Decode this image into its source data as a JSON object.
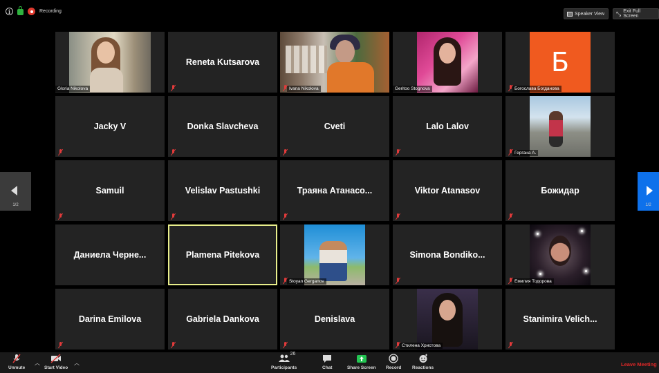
{
  "topbar": {
    "recording_label": "Recording",
    "speaker_view_label": "Speaker View",
    "fullscreen_label": "Exit Full Screen"
  },
  "participants": [
    {
      "name": "Gloria Nikolova",
      "display": "label"
    },
    {
      "name": "Reneta Kutsarova",
      "display": "name"
    },
    {
      "name": "Ivana Nikolova",
      "display": "label"
    },
    {
      "name": "Geritoo Stognova",
      "display": "label"
    },
    {
      "name": "Богослава Богданова",
      "display": "label"
    },
    {
      "name": "Jacky V",
      "display": "name"
    },
    {
      "name": "Donka Slavcheva",
      "display": "name"
    },
    {
      "name": "Cveti",
      "display": "name"
    },
    {
      "name": "Lalo Lalov",
      "display": "name"
    },
    {
      "name": "Гергана А.",
      "display": "label"
    },
    {
      "name": "Samuil",
      "display": "name"
    },
    {
      "name": "Velislav Pastushki",
      "display": "name"
    },
    {
      "name": "Траяна  Атанасо...",
      "display": "name"
    },
    {
      "name": "Viktor Atanasov",
      "display": "name"
    },
    {
      "name": "Божидар",
      "display": "name"
    },
    {
      "name": "Даниела  Черне...",
      "display": "name"
    },
    {
      "name": "Plamena Pitekova",
      "display": "name"
    },
    {
      "name": "Stoyan Gerganov",
      "display": "label"
    },
    {
      "name": "Simona  Bondiko...",
      "display": "name"
    },
    {
      "name": "Емилия Тодорова",
      "display": "label"
    },
    {
      "name": "Darina Emilova",
      "display": "name"
    },
    {
      "name": "Gabriela Dankova",
      "display": "name"
    },
    {
      "name": "Denislava",
      "display": "name"
    },
    {
      "name": "Стилена Христова",
      "display": "label"
    },
    {
      "name": "Stanimira  Velich...",
      "display": "name"
    }
  ],
  "nav": {
    "left_page": "1/2",
    "right_page": "1/2"
  },
  "toolbar": {
    "unmute_label": "Unmute",
    "start_video_label": "Start Video",
    "participants_label": "Participants",
    "participants_count": "26",
    "chat_label": "Chat",
    "share_label": "Share Screen",
    "record_label": "Record",
    "reactions_label": "Reactions",
    "leave_label": "Leave Meeting"
  },
  "colors": {
    "active_speaker_border": "#e8ee8b",
    "share_screen_green": "#23c552",
    "leave_red": "#e02828",
    "next_page_blue": "#0e71eb"
  }
}
